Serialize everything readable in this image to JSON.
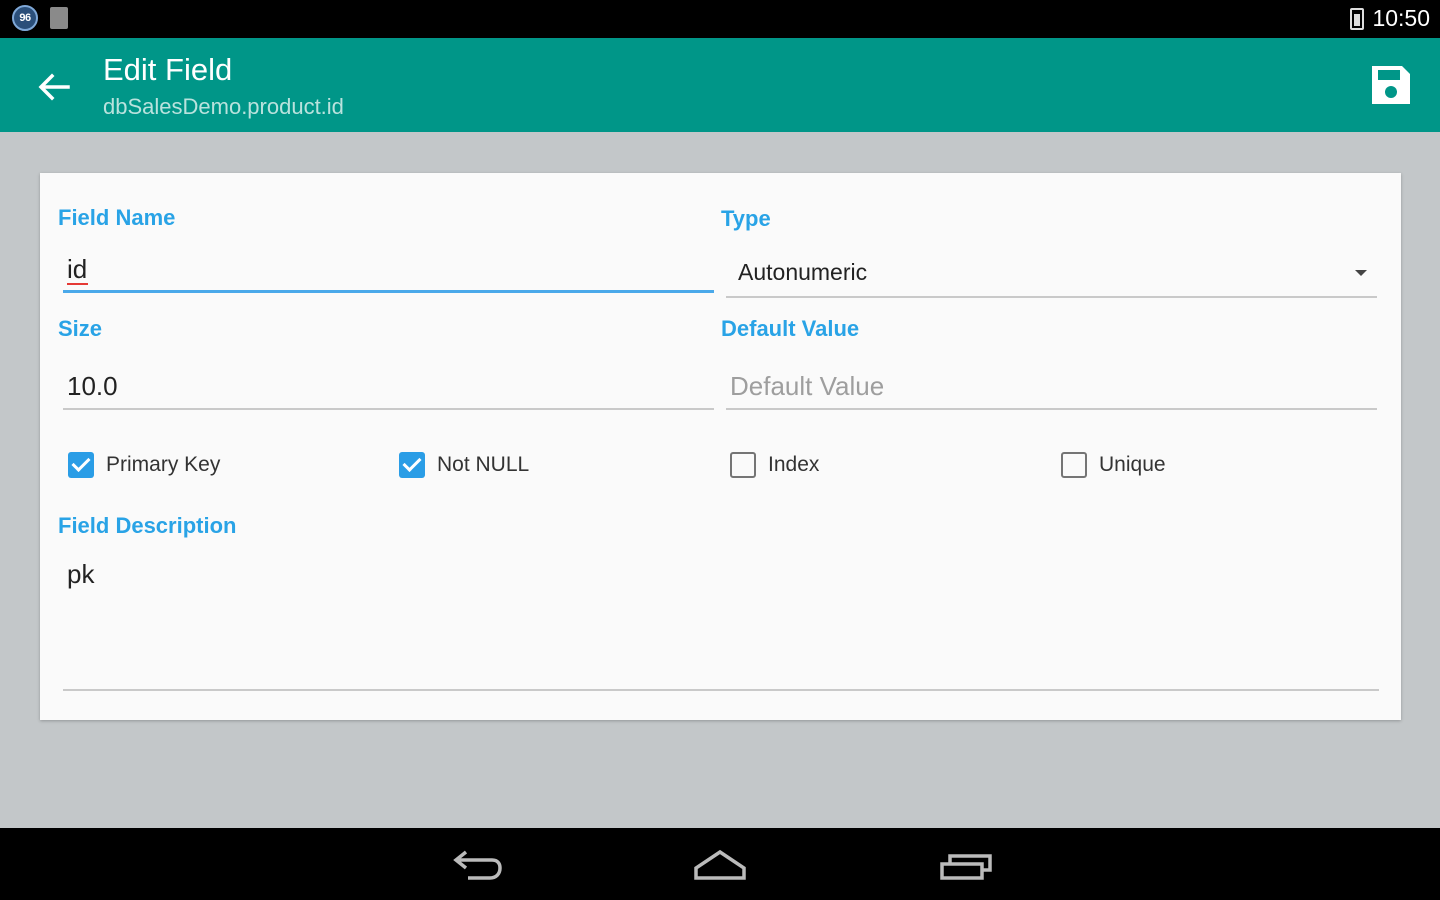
{
  "status_bar": {
    "notification_badge": "96",
    "time": "10:50",
    "icons": [
      "app-notification-icon",
      "document-notification-icon",
      "battery-icon"
    ]
  },
  "app_bar": {
    "title": "Edit Field",
    "subtitle": "dbSalesDemo.product.id",
    "color": "#009688",
    "icons": {
      "back": "arrow-back-icon",
      "save": "floppy-disk-save-icon"
    }
  },
  "form": {
    "field_name": {
      "label": "Field Name",
      "value": "id",
      "placeholder": ""
    },
    "type": {
      "label": "Type",
      "selected": "Autonumeric"
    },
    "size": {
      "label": "Size",
      "value": "10.0",
      "placeholder": ""
    },
    "default_value": {
      "label": "Default Value",
      "value": "",
      "placeholder": "Default Value"
    },
    "checkboxes": [
      {
        "label": "Primary Key",
        "checked": true
      },
      {
        "label": "Not NULL",
        "checked": true
      },
      {
        "label": "Index",
        "checked": false
      },
      {
        "label": "Unique",
        "checked": false
      }
    ],
    "description": {
      "label": "Field Description",
      "value": "pk"
    },
    "accent_color": "#29a3e6"
  },
  "nav_bar": {
    "icons": [
      "back-nav-icon",
      "home-nav-icon",
      "recent-apps-nav-icon"
    ]
  }
}
